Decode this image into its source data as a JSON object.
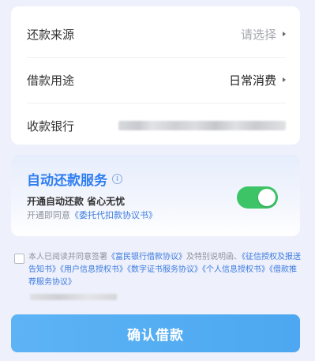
{
  "form": {
    "repay_source": {
      "label": "还款来源",
      "value": "请选择"
    },
    "loan_purpose": {
      "label": "借款用途",
      "value": "日常消费"
    },
    "receive_bank": {
      "label": "收款银行",
      "value": ""
    }
  },
  "auto_repay": {
    "title": "自动还款服务",
    "subtitle": "开通自动还款 省心无忧",
    "note_prefix": "开通即同意",
    "note_link": "《委托代扣款协议书》",
    "enabled": true,
    "colors": {
      "title": "#2f7ef0",
      "toggle_on": "#3cc467"
    }
  },
  "agreement": {
    "text1": "本人已阅读并同意签署",
    "link1": "《富民银行借款协议》",
    "text2": "及特别说明函、",
    "link2": "《征信授权及报送告知书》",
    "link3": "《用户信息授权书》",
    "link4": "《数字证书服务协议》",
    "link5": "《个人信息授权书》",
    "link6": "《借款推荐服务协议》"
  },
  "confirm_button": {
    "label": "确认借款",
    "color": "#4da8f1"
  }
}
